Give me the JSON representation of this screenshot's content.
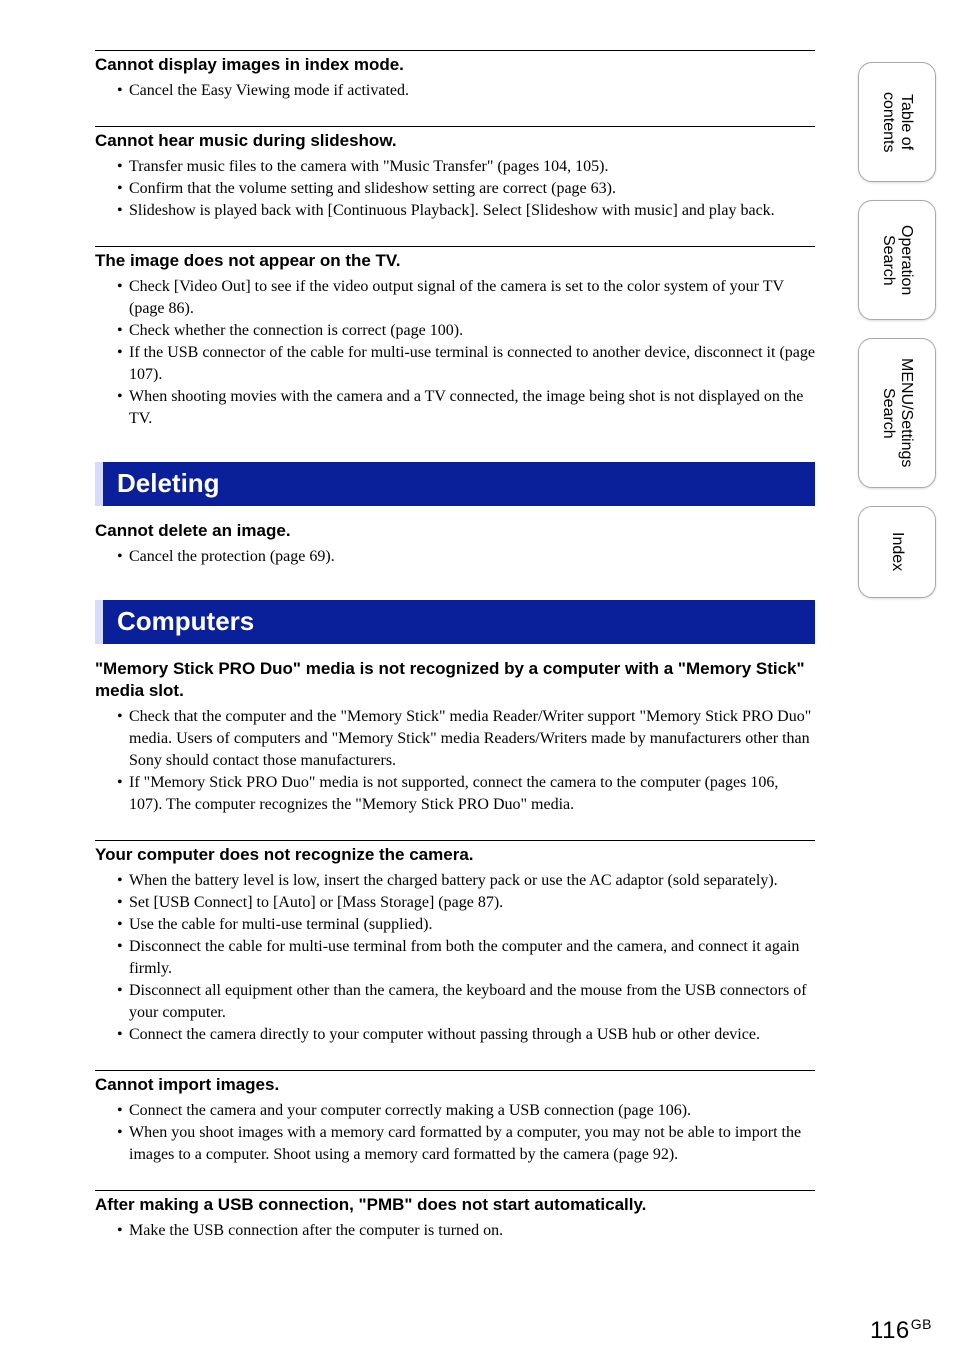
{
  "sidetabs": {
    "toc": "Table of\ncontents",
    "opsearch": "Operation\nSearch",
    "menusettings": "MENU/Settings\nSearch",
    "index": "Index"
  },
  "sections": {
    "s1": {
      "title": "Cannot display images in index mode.",
      "items": [
        "Cancel the Easy Viewing mode if activated."
      ]
    },
    "s2": {
      "title": "Cannot hear music during slideshow.",
      "items": [
        "Transfer music files to the camera with \"Music Transfer\" (pages 104, 105).",
        "Confirm that the volume setting and slideshow setting are correct (page 63).",
        "Slideshow is played back with [Continuous Playback]. Select [Slideshow with music] and play back."
      ]
    },
    "s3": {
      "title": "The image does not appear on the TV.",
      "items": [
        "Check [Video Out] to see if the video output signal of the camera is set to the color system of your TV (page 86).",
        "Check whether the connection is correct (page 100).",
        "If the USB connector of the cable for multi-use terminal is connected to another device, disconnect it (page 107).",
        "When shooting movies with the camera and a TV connected, the image being shot is not displayed on the TV."
      ]
    },
    "h1": "Deleting",
    "s4": {
      "title": "Cannot delete an image.",
      "items": [
        "Cancel the protection (page 69)."
      ]
    },
    "h2": "Computers",
    "s5": {
      "title": "\"Memory Stick PRO Duo\" media is not recognized by a computer with a \"Memory Stick\" media slot.",
      "items": [
        "Check that the computer and the \"Memory Stick\" media Reader/Writer support \"Memory Stick PRO Duo\" media. Users of computers and \"Memory Stick\" media Readers/Writers made by manufacturers other than Sony should contact those manufacturers.",
        "If \"Memory Stick PRO Duo\" media is not supported, connect the camera to the computer (pages 106, 107). The computer recognizes the \"Memory Stick PRO Duo\" media."
      ]
    },
    "s6": {
      "title": "Your computer does not recognize the camera.",
      "items": [
        "When the battery level is low, insert the charged battery pack or use the AC adaptor (sold separately).",
        "Set [USB Connect] to [Auto] or [Mass Storage] (page 87).",
        "Use the cable for multi-use terminal (supplied).",
        "Disconnect the cable for multi-use terminal from both the computer and the camera, and connect it again firmly.",
        "Disconnect all equipment other than the camera, the keyboard and the mouse from the USB connectors of your computer.",
        "Connect the camera directly to your computer without passing through a USB hub or other device."
      ]
    },
    "s7": {
      "title": "Cannot import images.",
      "items": [
        "Connect the camera and your computer correctly making a USB connection (page 106).",
        "When you shoot images with a memory card formatted by a computer, you may not be able to import the images to a computer. Shoot using a memory card formatted by the camera (page 92)."
      ]
    },
    "s8": {
      "title": "After making a USB connection, \"PMB\" does not start automatically.",
      "items": [
        "Make the USB connection after the computer is turned on."
      ]
    }
  },
  "page": {
    "num": "116",
    "region": "GB"
  }
}
